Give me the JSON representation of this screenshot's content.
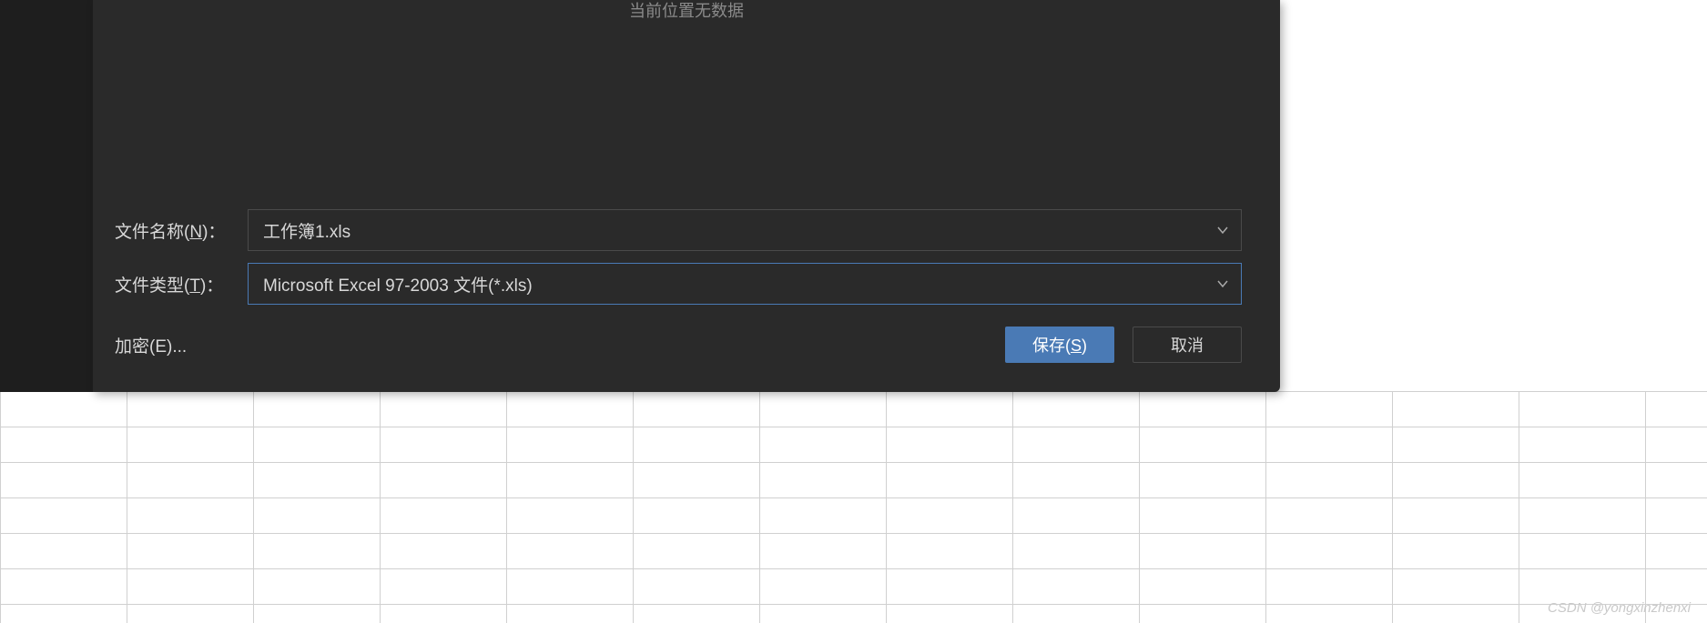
{
  "dialog": {
    "empty_message": "当前位置无数据",
    "filename_label_pre": "文件名称(",
    "filename_label_key": "N",
    "filename_label_post": ")：",
    "filename_value": "工作簿1.xls",
    "filetype_label_pre": "文件类型(",
    "filetype_label_key": "T",
    "filetype_label_post": ")：",
    "filetype_value": "Microsoft Excel 97-2003 文件(*.xls)",
    "encrypt_label": "加密(E)...",
    "save_label_pre": "保存(",
    "save_label_key": "S",
    "save_label_post": ")",
    "cancel_label": "取消"
  },
  "watermark": "CSDN @yongxinzhenxi"
}
